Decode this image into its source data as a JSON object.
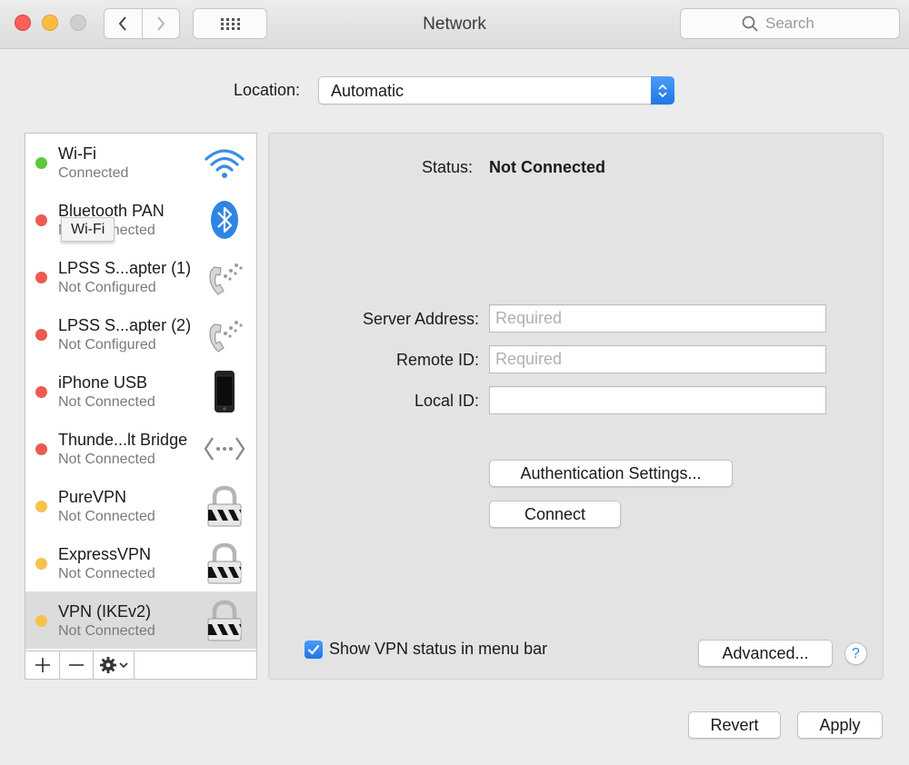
{
  "window": {
    "title": "Network",
    "search_placeholder": "Search"
  },
  "location": {
    "label": "Location:",
    "value": "Automatic"
  },
  "services": [
    {
      "name": "Wi-Fi",
      "status": "Connected",
      "dot_color": "#5cc83d",
      "icon": "wifi-icon"
    },
    {
      "name": "Bluetooth PAN",
      "status": "Not Connected",
      "dot_color": "#ec5a52",
      "icon": "bluetooth-icon"
    },
    {
      "name": "LPSS S...apter (1)",
      "status": "Not Configured",
      "dot_color": "#ec5a52",
      "icon": "phone-modem-icon"
    },
    {
      "name": "LPSS S...apter (2)",
      "status": "Not Configured",
      "dot_color": "#ec5a52",
      "icon": "phone-modem-icon"
    },
    {
      "name": "iPhone USB",
      "status": "Not Connected",
      "dot_color": "#ec5a52",
      "icon": "iphone-icon"
    },
    {
      "name": "Thunde...lt Bridge",
      "status": "Not Connected",
      "dot_color": "#ec5a52",
      "icon": "bridge-icon"
    },
    {
      "name": "PureVPN",
      "status": "Not Connected",
      "dot_color": "#f5c24a",
      "icon": "lock-icon"
    },
    {
      "name": "ExpressVPN",
      "status": "Not Connected",
      "dot_color": "#f5c24a",
      "icon": "lock-icon"
    },
    {
      "name": "VPN (IKEv2)",
      "status": "Not Connected",
      "dot_color": "#f5c24a",
      "icon": "lock-icon",
      "selected": true
    }
  ],
  "tooltip": "Wi-Fi",
  "toolbar": {
    "add": "+",
    "remove": "—"
  },
  "panel": {
    "status_label": "Status:",
    "status_value": "Not Connected",
    "server_address_label": "Server Address:",
    "server_address_placeholder": "Required",
    "remote_id_label": "Remote ID:",
    "remote_id_placeholder": "Required",
    "local_id_label": "Local ID:",
    "local_id_value": "",
    "auth_button": "Authentication Settings...",
    "connect_button": "Connect",
    "show_status_label": "Show VPN status in menu bar",
    "show_status_checked": true,
    "advanced_button": "Advanced...",
    "help_button": "?"
  },
  "footer": {
    "revert": "Revert",
    "apply": "Apply"
  },
  "colors": {
    "accent": "#1f77e8",
    "connected": "#5cc83d",
    "disconnected": "#ec5a52",
    "vpn_inactive": "#f5c24a"
  }
}
